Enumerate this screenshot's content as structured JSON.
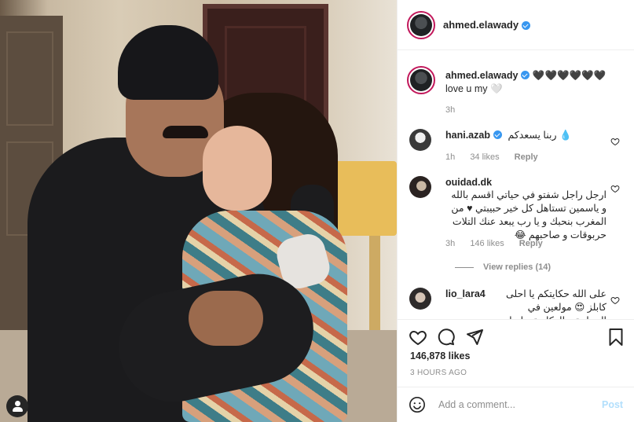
{
  "post": {
    "username": "ahmed.elawady",
    "verified": true
  },
  "caption": {
    "username": "ahmed.elawady",
    "text": "🖤🖤🖤🖤🖤🖤 love u my 🤍",
    "time": "3h"
  },
  "comments": [
    {
      "username": "hani.azab",
      "verified": true,
      "text": "ربنا يسعدكم 💧",
      "time": "1h",
      "likes": "34 likes",
      "reply": "Reply"
    },
    {
      "username": "ouidad.dk",
      "verified": false,
      "text": "ارجل راجل شفتو في حياتي اقسم بالله و ياسمين تستاهل كل خير حبيبتي ♥ من المغرب بنحبك و يا رب يبعد عنك التلات حربوقات و صاحبهم 😂",
      "time": "3h",
      "likes": "146 likes",
      "reply": "Reply",
      "view_replies": "View replies (14)"
    },
    {
      "username": "lio_lara4",
      "verified": false,
      "text": "على الله حكايتكم يا احلى كابلز 😍 مولعين في الحرابيق والعكازيق دايما يارب"
    }
  ],
  "actions": {
    "like_icon": "heart-icon",
    "comment_icon": "comment-icon",
    "share_icon": "paper-plane-icon",
    "save_icon": "bookmark-icon"
  },
  "likes": "146,878 likes",
  "posted": "3 HOURS AGO",
  "add_comment": {
    "placeholder": "Add a comment...",
    "post_label": "Post"
  },
  "colors": {
    "verified": "#3897f0",
    "post_button": "#b2dffc",
    "meta_text": "#8e8e8e",
    "story_ring": "#c2185b"
  }
}
